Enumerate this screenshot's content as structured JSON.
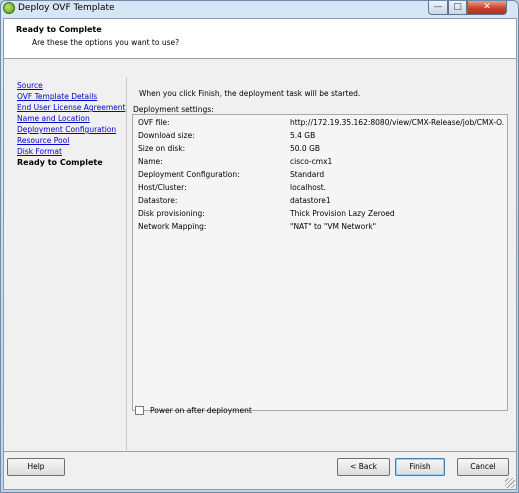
{
  "window": {
    "title": "Deploy OVF Template",
    "controls": {
      "minimize": "—",
      "maximize": "□",
      "close": "✕"
    }
  },
  "header": {
    "title": "Ready to Complete",
    "subtitle": "Are these the options you want to use?"
  },
  "nav": {
    "items": [
      {
        "label": "Source",
        "current": false
      },
      {
        "label": "OVF Template Details",
        "current": false
      },
      {
        "label": "End User License Agreement",
        "current": false
      },
      {
        "label": "Name and Location",
        "current": false
      },
      {
        "label": "Deployment Configuration",
        "current": false
      },
      {
        "label": "Resource Pool",
        "current": false
      },
      {
        "label": "Disk Format",
        "current": false
      },
      {
        "label": "Ready to Complete",
        "current": true
      }
    ]
  },
  "main": {
    "info_text": "When you click Finish, the deployment task will be started.",
    "settings_label": "Deployment settings:",
    "settings": [
      {
        "key": "OVF file:",
        "value": "http://172.19.35.162:8080/view/CMX-Release/job/CMX-O..."
      },
      {
        "key": "Download size:",
        "value": "5.4 GB"
      },
      {
        "key": "Size on disk:",
        "value": "50.0 GB"
      },
      {
        "key": "Name:",
        "value": "cisco-cmx1"
      },
      {
        "key": "Deployment Configuration:",
        "value": "Standard"
      },
      {
        "key": "Host/Cluster:",
        "value": "localhost."
      },
      {
        "key": "Datastore:",
        "value": "datastore1"
      },
      {
        "key": "Disk provisioning:",
        "value": "Thick Provision Lazy Zeroed"
      },
      {
        "key": "Network Mapping:",
        "value": "\"NAT\" to \"VM Network\""
      }
    ],
    "power_on_label": "Power on after deployment",
    "power_on_checked": false
  },
  "footer": {
    "help": "Help",
    "back": "< Back",
    "finish": "Finish",
    "cancel": "Cancel"
  }
}
